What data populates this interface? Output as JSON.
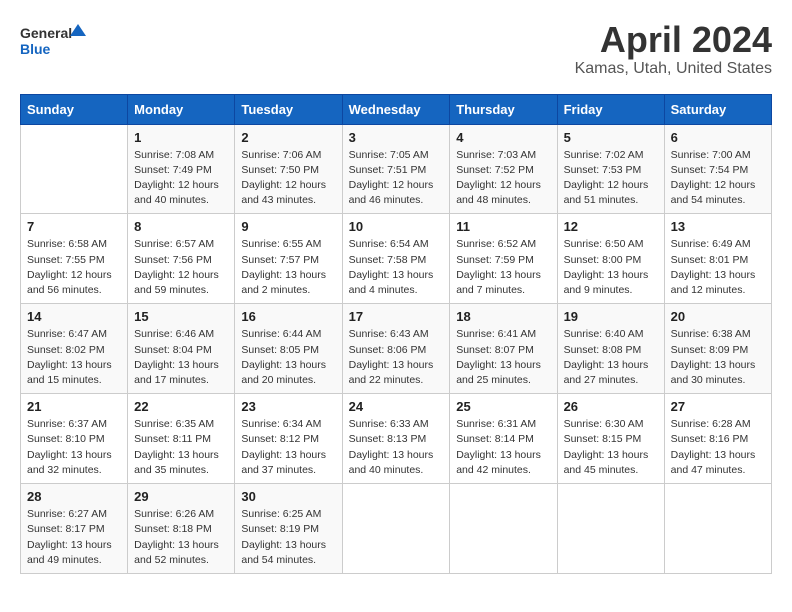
{
  "logo": {
    "line1": "General",
    "line2": "Blue"
  },
  "title": "April 2024",
  "subtitle": "Kamas, Utah, United States",
  "days_of_week": [
    "Sunday",
    "Monday",
    "Tuesday",
    "Wednesday",
    "Thursday",
    "Friday",
    "Saturday"
  ],
  "weeks": [
    [
      {
        "day": "",
        "sunrise": "",
        "sunset": "",
        "daylight": ""
      },
      {
        "day": "1",
        "sunrise": "Sunrise: 7:08 AM",
        "sunset": "Sunset: 7:49 PM",
        "daylight": "Daylight: 12 hours and 40 minutes."
      },
      {
        "day": "2",
        "sunrise": "Sunrise: 7:06 AM",
        "sunset": "Sunset: 7:50 PM",
        "daylight": "Daylight: 12 hours and 43 minutes."
      },
      {
        "day": "3",
        "sunrise": "Sunrise: 7:05 AM",
        "sunset": "Sunset: 7:51 PM",
        "daylight": "Daylight: 12 hours and 46 minutes."
      },
      {
        "day": "4",
        "sunrise": "Sunrise: 7:03 AM",
        "sunset": "Sunset: 7:52 PM",
        "daylight": "Daylight: 12 hours and 48 minutes."
      },
      {
        "day": "5",
        "sunrise": "Sunrise: 7:02 AM",
        "sunset": "Sunset: 7:53 PM",
        "daylight": "Daylight: 12 hours and 51 minutes."
      },
      {
        "day": "6",
        "sunrise": "Sunrise: 7:00 AM",
        "sunset": "Sunset: 7:54 PM",
        "daylight": "Daylight: 12 hours and 54 minutes."
      }
    ],
    [
      {
        "day": "7",
        "sunrise": "Sunrise: 6:58 AM",
        "sunset": "Sunset: 7:55 PM",
        "daylight": "Daylight: 12 hours and 56 minutes."
      },
      {
        "day": "8",
        "sunrise": "Sunrise: 6:57 AM",
        "sunset": "Sunset: 7:56 PM",
        "daylight": "Daylight: 12 hours and 59 minutes."
      },
      {
        "day": "9",
        "sunrise": "Sunrise: 6:55 AM",
        "sunset": "Sunset: 7:57 PM",
        "daylight": "Daylight: 13 hours and 2 minutes."
      },
      {
        "day": "10",
        "sunrise": "Sunrise: 6:54 AM",
        "sunset": "Sunset: 7:58 PM",
        "daylight": "Daylight: 13 hours and 4 minutes."
      },
      {
        "day": "11",
        "sunrise": "Sunrise: 6:52 AM",
        "sunset": "Sunset: 7:59 PM",
        "daylight": "Daylight: 13 hours and 7 minutes."
      },
      {
        "day": "12",
        "sunrise": "Sunrise: 6:50 AM",
        "sunset": "Sunset: 8:00 PM",
        "daylight": "Daylight: 13 hours and 9 minutes."
      },
      {
        "day": "13",
        "sunrise": "Sunrise: 6:49 AM",
        "sunset": "Sunset: 8:01 PM",
        "daylight": "Daylight: 13 hours and 12 minutes."
      }
    ],
    [
      {
        "day": "14",
        "sunrise": "Sunrise: 6:47 AM",
        "sunset": "Sunset: 8:02 PM",
        "daylight": "Daylight: 13 hours and 15 minutes."
      },
      {
        "day": "15",
        "sunrise": "Sunrise: 6:46 AM",
        "sunset": "Sunset: 8:04 PM",
        "daylight": "Daylight: 13 hours and 17 minutes."
      },
      {
        "day": "16",
        "sunrise": "Sunrise: 6:44 AM",
        "sunset": "Sunset: 8:05 PM",
        "daylight": "Daylight: 13 hours and 20 minutes."
      },
      {
        "day": "17",
        "sunrise": "Sunrise: 6:43 AM",
        "sunset": "Sunset: 8:06 PM",
        "daylight": "Daylight: 13 hours and 22 minutes."
      },
      {
        "day": "18",
        "sunrise": "Sunrise: 6:41 AM",
        "sunset": "Sunset: 8:07 PM",
        "daylight": "Daylight: 13 hours and 25 minutes."
      },
      {
        "day": "19",
        "sunrise": "Sunrise: 6:40 AM",
        "sunset": "Sunset: 8:08 PM",
        "daylight": "Daylight: 13 hours and 27 minutes."
      },
      {
        "day": "20",
        "sunrise": "Sunrise: 6:38 AM",
        "sunset": "Sunset: 8:09 PM",
        "daylight": "Daylight: 13 hours and 30 minutes."
      }
    ],
    [
      {
        "day": "21",
        "sunrise": "Sunrise: 6:37 AM",
        "sunset": "Sunset: 8:10 PM",
        "daylight": "Daylight: 13 hours and 32 minutes."
      },
      {
        "day": "22",
        "sunrise": "Sunrise: 6:35 AM",
        "sunset": "Sunset: 8:11 PM",
        "daylight": "Daylight: 13 hours and 35 minutes."
      },
      {
        "day": "23",
        "sunrise": "Sunrise: 6:34 AM",
        "sunset": "Sunset: 8:12 PM",
        "daylight": "Daylight: 13 hours and 37 minutes."
      },
      {
        "day": "24",
        "sunrise": "Sunrise: 6:33 AM",
        "sunset": "Sunset: 8:13 PM",
        "daylight": "Daylight: 13 hours and 40 minutes."
      },
      {
        "day": "25",
        "sunrise": "Sunrise: 6:31 AM",
        "sunset": "Sunset: 8:14 PM",
        "daylight": "Daylight: 13 hours and 42 minutes."
      },
      {
        "day": "26",
        "sunrise": "Sunrise: 6:30 AM",
        "sunset": "Sunset: 8:15 PM",
        "daylight": "Daylight: 13 hours and 45 minutes."
      },
      {
        "day": "27",
        "sunrise": "Sunrise: 6:28 AM",
        "sunset": "Sunset: 8:16 PM",
        "daylight": "Daylight: 13 hours and 47 minutes."
      }
    ],
    [
      {
        "day": "28",
        "sunrise": "Sunrise: 6:27 AM",
        "sunset": "Sunset: 8:17 PM",
        "daylight": "Daylight: 13 hours and 49 minutes."
      },
      {
        "day": "29",
        "sunrise": "Sunrise: 6:26 AM",
        "sunset": "Sunset: 8:18 PM",
        "daylight": "Daylight: 13 hours and 52 minutes."
      },
      {
        "day": "30",
        "sunrise": "Sunrise: 6:25 AM",
        "sunset": "Sunset: 8:19 PM",
        "daylight": "Daylight: 13 hours and 54 minutes."
      },
      {
        "day": "",
        "sunrise": "",
        "sunset": "",
        "daylight": ""
      },
      {
        "day": "",
        "sunrise": "",
        "sunset": "",
        "daylight": ""
      },
      {
        "day": "",
        "sunrise": "",
        "sunset": "",
        "daylight": ""
      },
      {
        "day": "",
        "sunrise": "",
        "sunset": "",
        "daylight": ""
      }
    ]
  ]
}
